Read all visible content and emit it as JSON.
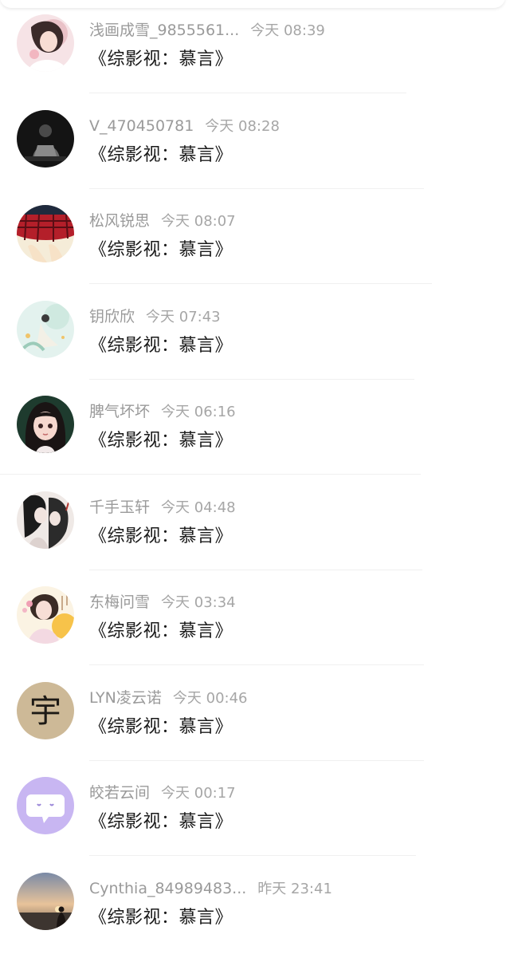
{
  "items": [
    {
      "name": "浅画成雪_9855561...",
      "time": "今天 08:39",
      "title": "《综影视：慕言》",
      "avatar": "portrait-pink"
    },
    {
      "name": "V_470450781",
      "time": "今天 08:28",
      "title": "《综影视：慕言》",
      "avatar": "dark-figure"
    },
    {
      "name": "松风锐思",
      "time": "今天 08:07",
      "title": "《综影视：慕言》",
      "avatar": "plaid-skirt"
    },
    {
      "name": "钥欣欣",
      "time": "今天 07:43",
      "title": "《综影视：慕言》",
      "avatar": "mint-figure"
    },
    {
      "name": "脾气坏坏",
      "time": "今天 06:16",
      "title": "《综影视：慕言》",
      "avatar": "anime-girl"
    },
    {
      "name": "千手玉轩",
      "time": "今天 04:48",
      "title": "《综影视：慕言》",
      "avatar": "ink-couple"
    },
    {
      "name": "东梅问雪",
      "time": "今天 03:34",
      "title": "《综影视：慕言》",
      "avatar": "floral-lady"
    },
    {
      "name": "LYN凌云诺",
      "time": "今天 00:46",
      "title": "《综影视：慕言》",
      "avatar": "character-glyph",
      "avatar_text": "宇"
    },
    {
      "name": "皎若云间",
      "time": "今天 00:17",
      "title": "《综影视：慕言》",
      "avatar": "chat-bubble"
    },
    {
      "name": "Cynthia_84989483...",
      "time": "昨天 23:41",
      "title": "《综影视：慕言》",
      "avatar": "sunset-silhouette"
    }
  ]
}
